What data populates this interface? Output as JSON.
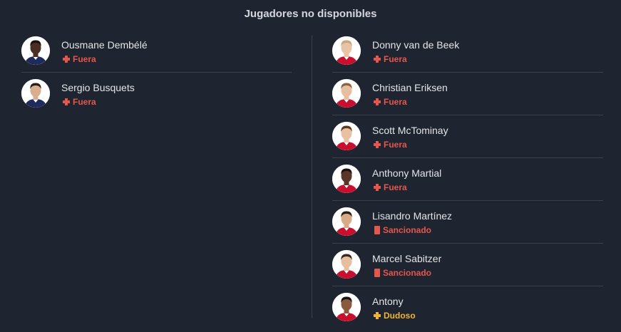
{
  "title": "Jugadores no disponibles",
  "colors": {
    "background": "#1e2430",
    "out": "#e5574c",
    "suspended": "#e5574c",
    "doubtful": "#f0b530"
  },
  "left": [
    {
      "name": "Ousmane Dembélé",
      "status": "Fuera",
      "type": "out",
      "shirt": "#1e2b5c",
      "skin": "#4a2e22",
      "hair": "#1a1210"
    },
    {
      "name": "Sergio Busquets",
      "status": "Fuera",
      "type": "out",
      "shirt": "#1e2b5c",
      "skin": "#d9ae8e",
      "hair": "#2a1d16"
    }
  ],
  "right": [
    {
      "name": "Donny van de Beek",
      "status": "Fuera",
      "type": "out",
      "shirt": "#c8102e",
      "skin": "#e9c3a5",
      "hair": "#c9a77a"
    },
    {
      "name": "Christian Eriksen",
      "status": "Fuera",
      "type": "out",
      "shirt": "#c8102e",
      "skin": "#e7bf9f",
      "hair": "#8a6440"
    },
    {
      "name": "Scott McTominay",
      "status": "Fuera",
      "type": "out",
      "shirt": "#c8102e",
      "skin": "#e8c0a2",
      "hair": "#5a3b22"
    },
    {
      "name": "Anthony Martial",
      "status": "Fuera",
      "type": "out",
      "shirt": "#c8102e",
      "skin": "#5a3626",
      "hair": "#1a1210"
    },
    {
      "name": "Lisandro Martínez",
      "status": "Sancionado",
      "type": "suspended",
      "shirt": "#c8102e",
      "skin": "#d8ab86",
      "hair": "#2a1d16"
    },
    {
      "name": "Marcel Sabitzer",
      "status": "Sancionado",
      "type": "suspended",
      "shirt": "#c8102e",
      "skin": "#e6bf9f",
      "hair": "#3a2a1e"
    },
    {
      "name": "Antony",
      "status": "Dudoso",
      "type": "doubtful",
      "shirt": "#c8102e",
      "skin": "#8a5a3e",
      "hair": "#1a1210"
    }
  ]
}
